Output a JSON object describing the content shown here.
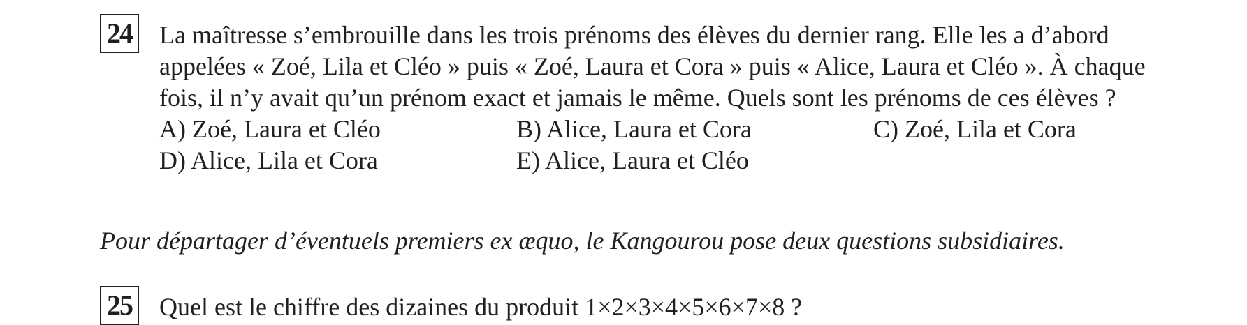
{
  "q24": {
    "number": "24",
    "lines": [
      "La maîtresse s’embrouille dans les trois prénoms des élèves du dernier rang. Elle les a d’abord",
      "appelées « Zoé, Lila et Cléo » puis « Zoé, Laura et Cora » puis « Alice, Laura et Cléo ». À chaque",
      "fois, il n’y avait qu’un prénom exact et jamais le même. Quels sont les prénoms de ces élèves ?"
    ],
    "choices": {
      "a": "A) Zoé, Laura et Cléo",
      "b": "B) Alice, Laura et Cora",
      "c": "C) Zoé, Lila et Cora",
      "d": "D) Alice, Lila et Cora",
      "e": "E) Alice, Laura et Cléo"
    }
  },
  "subsidiary_note": "Pour départager d’éventuels premiers ex æquo, le Kangourou pose deux questions subsidiaires.",
  "q25": {
    "number": "25",
    "text": "Quel est le chiffre des dizaines du produit 1×2×3×4×5×6×7×8 ?"
  }
}
